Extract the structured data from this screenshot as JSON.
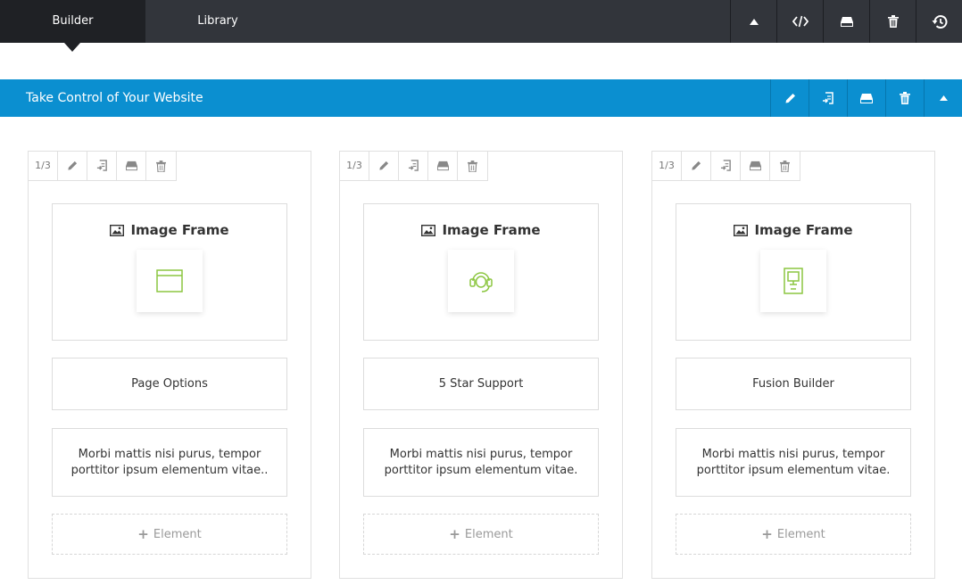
{
  "tabs": [
    {
      "label": "Builder",
      "active": true
    },
    {
      "label": "Library",
      "active": false
    }
  ],
  "top_icons": [
    "collapse-up-icon",
    "code-icon",
    "save-icon",
    "trash-icon",
    "history-icon"
  ],
  "section": {
    "title": "Take Control of Your Website",
    "icons": [
      "edit-icon",
      "clone-icon",
      "save-icon",
      "trash-icon",
      "collapse-up-icon"
    ]
  },
  "colors": {
    "topbar": "#32353b",
    "topbar_active": "#1f2125",
    "section": "#0b8fd0",
    "icon_accent": "#8cc640"
  },
  "columns": [
    {
      "size": "1/3",
      "image_frame_label": "Image Frame",
      "image_icon": "browser-window-icon",
      "title": "Page Options",
      "text": "Morbi mattis nisi purus, tempor porttitor ipsum elementum vitae..",
      "add_label": "Element"
    },
    {
      "size": "1/3",
      "image_frame_label": "Image Frame",
      "image_icon": "headset-support-icon",
      "title": "5 Star Support",
      "text": "Morbi mattis nisi purus, tempor porttitor ipsum elementum vitae.",
      "add_label": "Element"
    },
    {
      "size": "1/3",
      "image_frame_label": "Image Frame",
      "image_icon": "device-screen-icon",
      "title": "Fusion Builder",
      "text": "Morbi mattis nisi purus, tempor porttitor ipsum elementum vitae.",
      "add_label": "Element"
    }
  ]
}
